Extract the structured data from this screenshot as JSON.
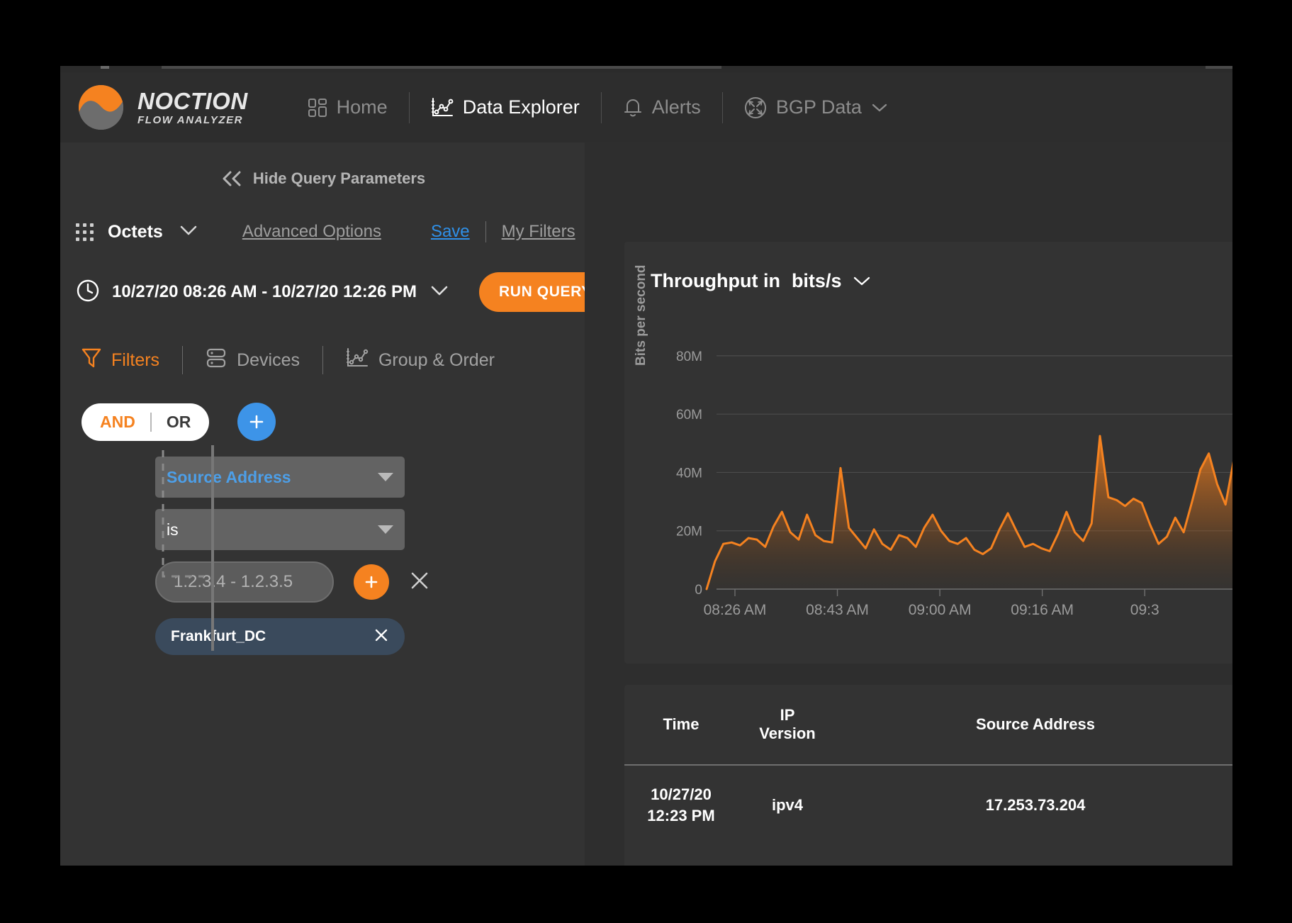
{
  "brand": {
    "title": "NOCTION",
    "subtitle": "FLOW ANALYZER"
  },
  "nav": {
    "items": [
      {
        "label": "Home",
        "icon": "grid-icon",
        "active": false
      },
      {
        "label": "Data Explorer",
        "icon": "line-chart-icon",
        "active": true
      },
      {
        "label": "Alerts",
        "icon": "bell-icon",
        "active": false
      },
      {
        "label": "BGP Data",
        "icon": "bgp-circle-icon",
        "active": false,
        "caret": true
      }
    ]
  },
  "panel": {
    "hide_params": "Hide Query Parameters",
    "metric": "Octets",
    "advanced_options": "Advanced Options",
    "save": "Save",
    "my_filters": "My Filters",
    "time_range": "10/27/20 08:26 AM - 10/27/20 12:26 PM",
    "run_query": "RUN QUERY",
    "tabs": [
      {
        "label": "Filters",
        "icon": "funnel-icon",
        "active": true
      },
      {
        "label": "Devices",
        "icon": "server-rack-icon",
        "active": false
      },
      {
        "label": "Group & Order",
        "icon": "line-chart-icon",
        "active": false
      }
    ],
    "logic": {
      "and": "AND",
      "or": "OR",
      "selected": "AND"
    },
    "filter": {
      "field": "Source Address",
      "operator": "is",
      "value_placeholder": "1.2.3.4 - 1.2.3.5",
      "value": "",
      "chip": "Frankfurt_DC"
    }
  },
  "chart_panel": {
    "title_prefix": "Throughput in",
    "unit": "bits/s"
  },
  "table": {
    "headers": [
      "Time",
      "IP Version",
      "Source Address"
    ],
    "rows": [
      {
        "time_date": "10/27/20",
        "time_clock": "12:23 PM",
        "ip_version": "ipv4",
        "source_address": "17.253.73.204"
      }
    ]
  },
  "colors": {
    "accent_orange": "#f58220",
    "link_blue": "#2f90e8",
    "field_blue": "#4d9fe8",
    "chip_bg": "#3a4a5c",
    "panel_bg": "#333333",
    "app_bg": "#2e2e2e"
  },
  "chart_data": {
    "type": "area",
    "title": "Throughput in bits/s",
    "xlabel": "",
    "ylabel": "Bits per second",
    "ylim": [
      0,
      88000000
    ],
    "ytick_labels": [
      "0",
      "20M",
      "40M",
      "60M",
      "80M"
    ],
    "ytick_values": [
      0,
      20000000,
      40000000,
      60000000,
      80000000
    ],
    "xtick_labels": [
      "08:26 AM",
      "08:43 AM",
      "09:00 AM",
      "09:16 AM",
      "09:3"
    ],
    "grid": true,
    "legend": "none",
    "line_color": "#f58220",
    "fill_gradient": [
      "#f58220",
      "#33333300"
    ],
    "series": [
      {
        "name": "Throughput",
        "values": [
          0,
          9500000,
          15500000,
          16000000,
          15000000,
          17500000,
          17000000,
          14500000,
          21500000,
          26500000,
          19500000,
          17000000,
          25500000,
          18500000,
          16500000,
          16000000,
          41500000,
          21000000,
          17500000,
          14000000,
          20500000,
          15500000,
          13500000,
          18500000,
          17500000,
          14500000,
          21000000,
          25500000,
          20000000,
          16500000,
          15500000,
          17500000,
          13500000,
          12000000,
          14000000,
          20500000,
          26000000,
          20000000,
          14500000,
          15500000,
          14000000,
          13000000,
          19000000,
          26500000,
          19500000,
          16500000,
          22500000,
          52500000,
          31500000,
          30500000,
          28500000,
          31000000,
          29500000,
          22000000,
          15500000,
          18000000,
          24500000,
          19500000,
          30000000,
          41000000,
          46500000,
          36000000,
          29000000,
          44500000
        ]
      }
    ]
  }
}
